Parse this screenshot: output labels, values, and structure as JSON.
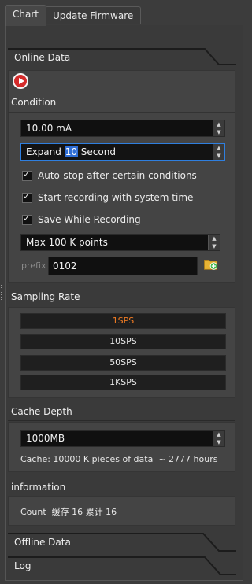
{
  "tabs": [
    {
      "label": "Chart",
      "active": true
    },
    {
      "label": "Update Firmware",
      "active": false
    }
  ],
  "online": {
    "title": "Online Data",
    "record_icon": "record-play-icon",
    "condition_title": "Condition",
    "stop_condition_value": "10.00 mA",
    "expand_prefix": "Expand ",
    "expand_selected": "10",
    "expand_suffix": " Second",
    "checkboxes": [
      {
        "label": "Auto-stop after certain conditions",
        "checked": true
      },
      {
        "label": "Start recording with system time",
        "checked": true
      },
      {
        "label": "Save While Recording",
        "checked": true
      }
    ],
    "max_points_value": "Max 100 K points",
    "prefix_label": "prefix",
    "prefix_value": "0102",
    "folder_icon": "folder-add-icon"
  },
  "sampling": {
    "title": "Sampling Rate",
    "options": [
      "1SPS",
      "10SPS",
      "50SPS",
      "1KSPS"
    ],
    "selected": "1SPS",
    "accent_color": "#f07b23"
  },
  "cache": {
    "title": "Cache Depth",
    "value": "1000MB",
    "info_text": "Cache: 10000 K pieces of data  ~ 2777 hours"
  },
  "information": {
    "title": "information",
    "text": "Count  缓存 16 累计 16"
  },
  "offline": {
    "title": "Offline Data"
  },
  "log": {
    "title": "Log"
  }
}
